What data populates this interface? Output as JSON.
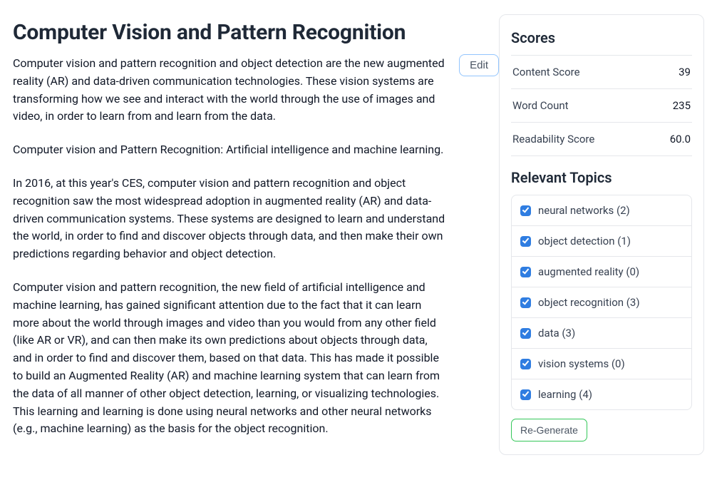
{
  "title": "Computer Vision and Pattern Recognition",
  "edit_label": "Edit",
  "paragraphs": [
    "Computer vision and pattern recognition and object detection are the new augmented reality (AR) and data-driven communication technologies. These vision systems are transforming how we see and interact with the world through the use of images and video, in order to learn from and learn from the data.",
    "Computer vision and Pattern Recognition: Artificial intelligence and machine learning.",
    "In 2016, at this year's CES, computer vision and pattern recognition and object recognition saw the most widespread adoption in augmented reality (AR) and data-driven communication systems. These systems are designed to learn and understand the world, in order to find and discover objects through data, and then make their own predictions regarding behavior and object detection.",
    "Computer vision and pattern recognition, the new field of artificial intelligence and machine learning, has gained significant attention due to the fact that it can learn more about the world through images and video than you would from any other field (like AR or VR), and can then make its own predictions about objects through data, and in order to find and discover them, based on that data. This has made it possible to build an Augmented Reality (AR) and machine learning system that can learn from the data of all manner of other object detection, learning, or visualizing technologies. This learning and learning is done using neural networks and other neural networks (e.g., machine learning) as the basis for the object recognition."
  ],
  "scores": {
    "heading": "Scores",
    "rows": [
      {
        "label": "Content Score",
        "value": "39"
      },
      {
        "label": "Word Count",
        "value": "235"
      },
      {
        "label": "Readability Score",
        "value": "60.0"
      }
    ]
  },
  "topics": {
    "heading": "Relevant Topics",
    "items": [
      {
        "label": "neural networks (2)"
      },
      {
        "label": "object detection (1)"
      },
      {
        "label": "augmented reality (0)"
      },
      {
        "label": "object recognition (3)"
      },
      {
        "label": "data (3)"
      },
      {
        "label": "vision systems (0)"
      },
      {
        "label": "learning (4)"
      }
    ]
  },
  "regen_label": "Re-Generate"
}
